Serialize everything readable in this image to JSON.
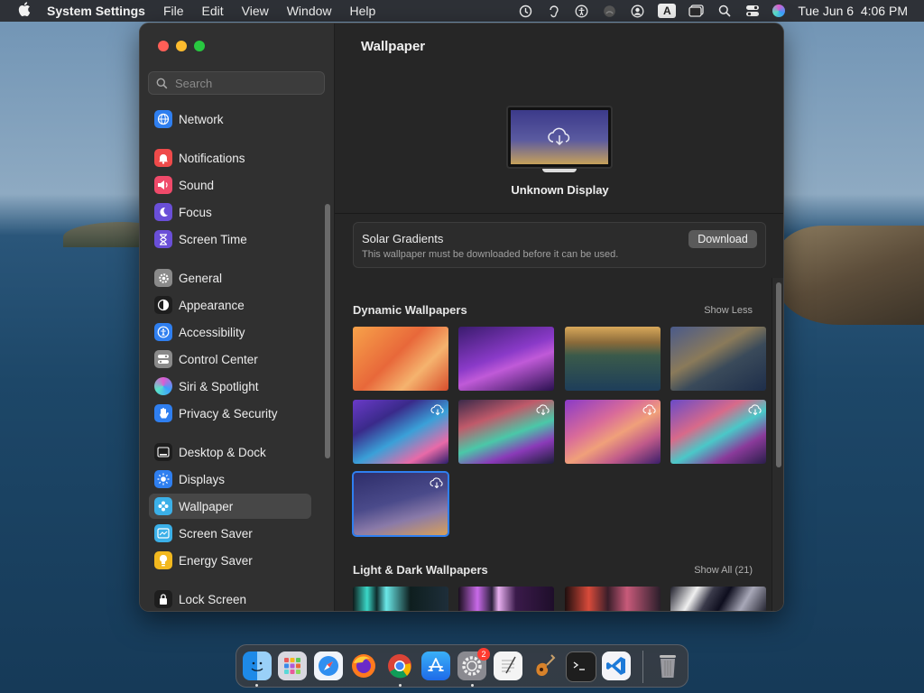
{
  "menubar": {
    "app_name": "System Settings",
    "menus": [
      "File",
      "Edit",
      "View",
      "Window",
      "Help"
    ],
    "input_source": "A",
    "clock": "Tue Jun 6  4:06 PM"
  },
  "sidebar": {
    "search_placeholder": "Search",
    "items": [
      {
        "label": "Network",
        "icon": "globe-icon",
        "color": "#2f7ff0"
      },
      {
        "label": "Notifications",
        "icon": "bell-icon",
        "color": "#ef4a4a"
      },
      {
        "label": "Sound",
        "icon": "speaker-icon",
        "color": "#ef4a6a"
      },
      {
        "label": "Focus",
        "icon": "moon-icon",
        "color": "#6a4fd8"
      },
      {
        "label": "Screen Time",
        "icon": "hourglass-icon",
        "color": "#6a4fd8"
      },
      {
        "label": "General",
        "icon": "gear-icon",
        "color": "#8a8a8a"
      },
      {
        "label": "Appearance",
        "icon": "appearance-icon",
        "color": "#1e1e1e"
      },
      {
        "label": "Accessibility",
        "icon": "accessibility-icon",
        "color": "#2f7ff0"
      },
      {
        "label": "Control Center",
        "icon": "switches-icon",
        "color": "#8a8a8a"
      },
      {
        "label": "Siri & Spotlight",
        "icon": "siri-icon",
        "color": "#b04ad8"
      },
      {
        "label": "Privacy & Security",
        "icon": "hand-icon",
        "color": "#2f7ff0"
      },
      {
        "label": "Desktop & Dock",
        "icon": "dock-icon",
        "color": "#1e1e1e"
      },
      {
        "label": "Displays",
        "icon": "sun-icon",
        "color": "#2f7ff0"
      },
      {
        "label": "Wallpaper",
        "icon": "flower-icon",
        "color": "#3bb0e8"
      },
      {
        "label": "Screen Saver",
        "icon": "screensaver-icon",
        "color": "#3bb0e8"
      },
      {
        "label": "Energy Saver",
        "icon": "battery-icon",
        "color": "#f2b81e"
      },
      {
        "label": "Lock Screen",
        "icon": "lock-icon",
        "color": "#1e1e1e"
      }
    ],
    "selected": "Wallpaper"
  },
  "main": {
    "title": "Wallpaper",
    "display_name": "Unknown Display",
    "info": {
      "title": "Solar Gradients",
      "subtitle": "This wallpaper must be downloaded before it can be used.",
      "button": "Download"
    },
    "dynamic": {
      "title": "Dynamic Wallpapers",
      "action": "Show Less"
    },
    "light_dark": {
      "title": "Light & Dark Wallpapers",
      "action": "Show All (21)"
    }
  },
  "dock": {
    "apps": [
      "Finder",
      "Launchpad",
      "Safari",
      "Firefox",
      "Chrome",
      "App Store",
      "System Settings",
      "TextEdit",
      "GarageBand",
      "Terminal",
      "Visual Studio Code",
      "Trash"
    ],
    "settings_badge": "2"
  }
}
